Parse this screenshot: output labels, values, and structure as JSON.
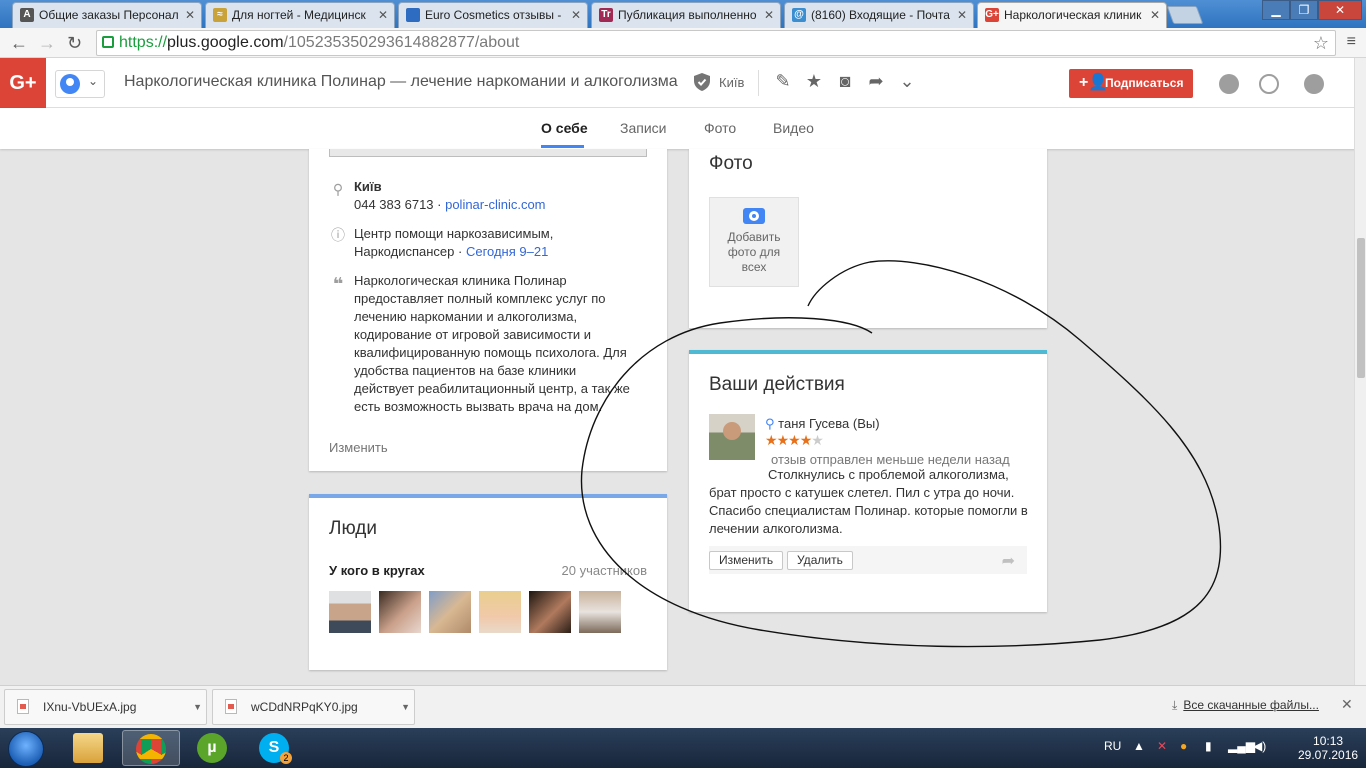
{
  "browser": {
    "tabs": [
      {
        "title": "Общие заказы Персонал",
        "icon_color": "#555555",
        "icon_text": "A"
      },
      {
        "title": "Для ногтей - Медицинск",
        "icon_color": "#c9a23a",
        "icon_text": "≈"
      },
      {
        "title": "Euro Cosmetics отзывы -",
        "icon_color": "#2d6cc0",
        "icon_text": ""
      },
      {
        "title": "Публикация выполненно",
        "icon_color": "#a12a55",
        "icon_text": "Tr"
      },
      {
        "title": "(8160) Входящие - Почта",
        "icon_color": "#3b8fd0",
        "icon_text": "@"
      },
      {
        "title": "Наркологическая клиник",
        "icon_color": "#db4437",
        "icon_text": "G+"
      }
    ],
    "url_scheme": "https://",
    "url_host": "plus.google.com",
    "url_path": "/105235350293614882877/about"
  },
  "header": {
    "logo": "G+",
    "title": "Наркологическая клиника Полинар — лечение наркомании и алкоголизма",
    "city": "Київ",
    "follow_label": "Подписаться",
    "follow_icon": "+👤"
  },
  "nav": {
    "tabs": [
      "О себе",
      "Записи",
      "Фото",
      "Видео"
    ],
    "active": "О себе"
  },
  "about_card": {
    "city": "Київ",
    "phone": "044 383 6713",
    "separator": " · ",
    "website": "polinar-clinic.com",
    "category": "Центр помощи наркозависимым,",
    "category2": "Наркодиспансер",
    "hours": "Сегодня 9–21",
    "description_lines": [
      "Наркологическая клиника Полинар",
      "предоставляет полный комплекс услуг по",
      "лечению наркомании и алкоголизма,",
      "кодирование от игровой зависимости и",
      "квалифицированную помощь психолога. Для",
      "удобства пациентов на базе клиники",
      "действует реабилитационный центр, а так же",
      "есть возможность вызвать врача на дом."
    ],
    "edit_label": "Изменить"
  },
  "people_card": {
    "title": "Люди",
    "subtitle": "У кого в кругах",
    "count": "20 участников",
    "accent": "#7aa7e8"
  },
  "photo_card": {
    "title": "Фото",
    "add_lines": [
      "Добавить",
      "фото для",
      "всех"
    ]
  },
  "actions_card": {
    "title": "Ваши действия",
    "accent": "#4fb8d2",
    "reviewer": "таня Гусева (Вы)",
    "rating": 4,
    "rating_max": 5,
    "when": "отзыв отправлен меньше недели назад",
    "text": "Столкнулись с проблемой алкоголизма, брат просто с катушек слетел. Пил с утра до ночи. Спасибо специалистам Полинар. которые помогли в лечении алкоголизма.",
    "edit_label": "Изменить",
    "delete_label": "Удалить"
  },
  "downloads": {
    "files": [
      "IXnu-VbUExA.jpg",
      "wCDdNRPqKY0.jpg"
    ],
    "all_label": "Все скачанные файлы..."
  },
  "taskbar": {
    "lang": "RU",
    "time": "10:13",
    "date": "29.07.2016",
    "skype_badge": "2"
  }
}
